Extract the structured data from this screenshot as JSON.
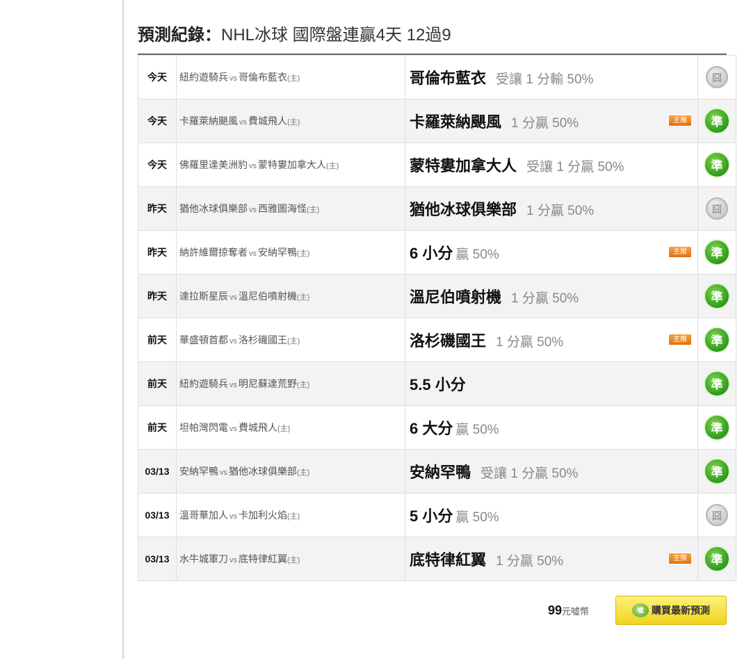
{
  "title": {
    "bold": "預測紀錄：",
    "rest": "NHL冰球 國際盤連贏4天 12過9"
  },
  "rows": [
    {
      "day": "今天",
      "away": "紐約遊騎兵",
      "vs": "vs",
      "home": "哥倫布藍衣",
      "home_tag": "(主)",
      "pick_team": "哥倫布藍衣",
      "pick_detail": "受讓 1 分輸 50%",
      "badge": "",
      "result": "push",
      "result_label": "囧"
    },
    {
      "day": "今天",
      "away": "卡羅萊納颶風",
      "vs": "vs",
      "home": "費城飛人",
      "home_tag": "(主)",
      "pick_team": "卡羅萊納颶風",
      "pick_detail": "1 分贏 50%",
      "badge": "主推",
      "result": "win",
      "result_label": "準"
    },
    {
      "day": "今天",
      "away": "佛羅里達美洲豹",
      "vs": "vs",
      "home": "蒙特婁加拿大人",
      "home_tag": "(主)",
      "pick_team": "蒙特婁加拿大人",
      "pick_detail": "受讓 1 分贏 50%",
      "badge": "",
      "result": "win",
      "result_label": "準"
    },
    {
      "day": "昨天",
      "away": "猶他冰球俱樂部",
      "vs": "vs",
      "home": "西雅圖海怪",
      "home_tag": "(主)",
      "pick_team": "猶他冰球俱樂部",
      "pick_detail": "1 分贏 50%",
      "badge": "",
      "result": "push",
      "result_label": "囧"
    },
    {
      "day": "昨天",
      "away": "納許維爾掠奪者",
      "vs": "vs",
      "home": "安納罕鴨",
      "home_tag": "(主)",
      "pick_team": "6 小分",
      "pick_detail": "贏 50%",
      "badge": "主推",
      "result": "win",
      "result_label": "準"
    },
    {
      "day": "昨天",
      "away": "達拉斯星辰",
      "vs": "vs",
      "home": "溫尼伯噴射機",
      "home_tag": "(主)",
      "pick_team": "溫尼伯噴射機",
      "pick_detail": "1 分贏 50%",
      "badge": "",
      "result": "win",
      "result_label": "準"
    },
    {
      "day": "前天",
      "away": "華盛頓首都",
      "vs": "vs",
      "home": "洛杉磯國王",
      "home_tag": "(主)",
      "pick_team": "洛杉磯國王",
      "pick_detail": "1 分贏 50%",
      "badge": "主推",
      "result": "win",
      "result_label": "準"
    },
    {
      "day": "前天",
      "away": "紐約遊騎兵",
      "vs": "vs",
      "home": "明尼蘇達荒野",
      "home_tag": "(主)",
      "pick_team": "5.5 小分",
      "pick_detail": "",
      "badge": "",
      "result": "win",
      "result_label": "準"
    },
    {
      "day": "前天",
      "away": "坦帕灣閃電",
      "vs": "vs",
      "home": "費城飛人",
      "home_tag": "(主)",
      "pick_team": "6 大分",
      "pick_detail": "贏 50%",
      "badge": "",
      "result": "win",
      "result_label": "準"
    },
    {
      "day": "03/13",
      "away": "安納罕鴨",
      "vs": "vs",
      "home": "猶他冰球俱樂部",
      "home_tag": "(主)",
      "pick_team": "安納罕鴨",
      "pick_detail": "受讓 1 分贏 50%",
      "badge": "",
      "result": "win",
      "result_label": "準"
    },
    {
      "day": "03/13",
      "away": "溫哥華加人",
      "vs": "vs",
      "home": "卡加利火焰",
      "home_tag": "(主)",
      "pick_team": "5 小分",
      "pick_detail": "贏 50%",
      "badge": "",
      "result": "push",
      "result_label": "囧"
    },
    {
      "day": "03/13",
      "away": "水牛城軍刀",
      "vs": "vs",
      "home": "底特律紅翼",
      "home_tag": "(主)",
      "pick_team": "底特律紅翼",
      "pick_detail": "1 分贏 50%",
      "badge": "主推",
      "result": "win",
      "result_label": "準"
    }
  ],
  "purchase": {
    "price_amount": "99",
    "price_unit": "元噓幣",
    "buy_label": "購買最新預測",
    "coin_label": "噓"
  }
}
